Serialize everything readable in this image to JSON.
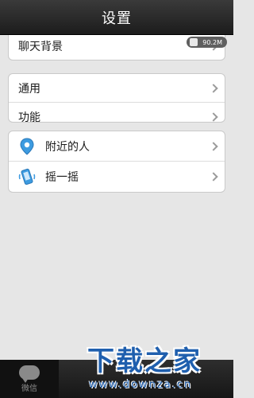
{
  "header": {
    "title": "设置"
  },
  "memory_badge": {
    "value": "90.2M"
  },
  "groups": {
    "g1": [
      {
        "label": "聊天背景"
      }
    ],
    "g2": [
      {
        "label": "通用"
      },
      {
        "label": "功能"
      }
    ],
    "g3": [
      {
        "label": "附近的人",
        "icon": "location-pin-icon"
      },
      {
        "label": "摇一摇",
        "icon": "phone-shake-icon"
      }
    ]
  },
  "tabbar": {
    "tab_label": "微信",
    "icon": "chat-bubble-icon"
  },
  "watermark": {
    "main": "下载之家",
    "sub": "www.downza.cn"
  },
  "colors": {
    "accent": "#1f5fae",
    "titlebar": "#2a2a2a",
    "background": "#e6e6e6"
  }
}
